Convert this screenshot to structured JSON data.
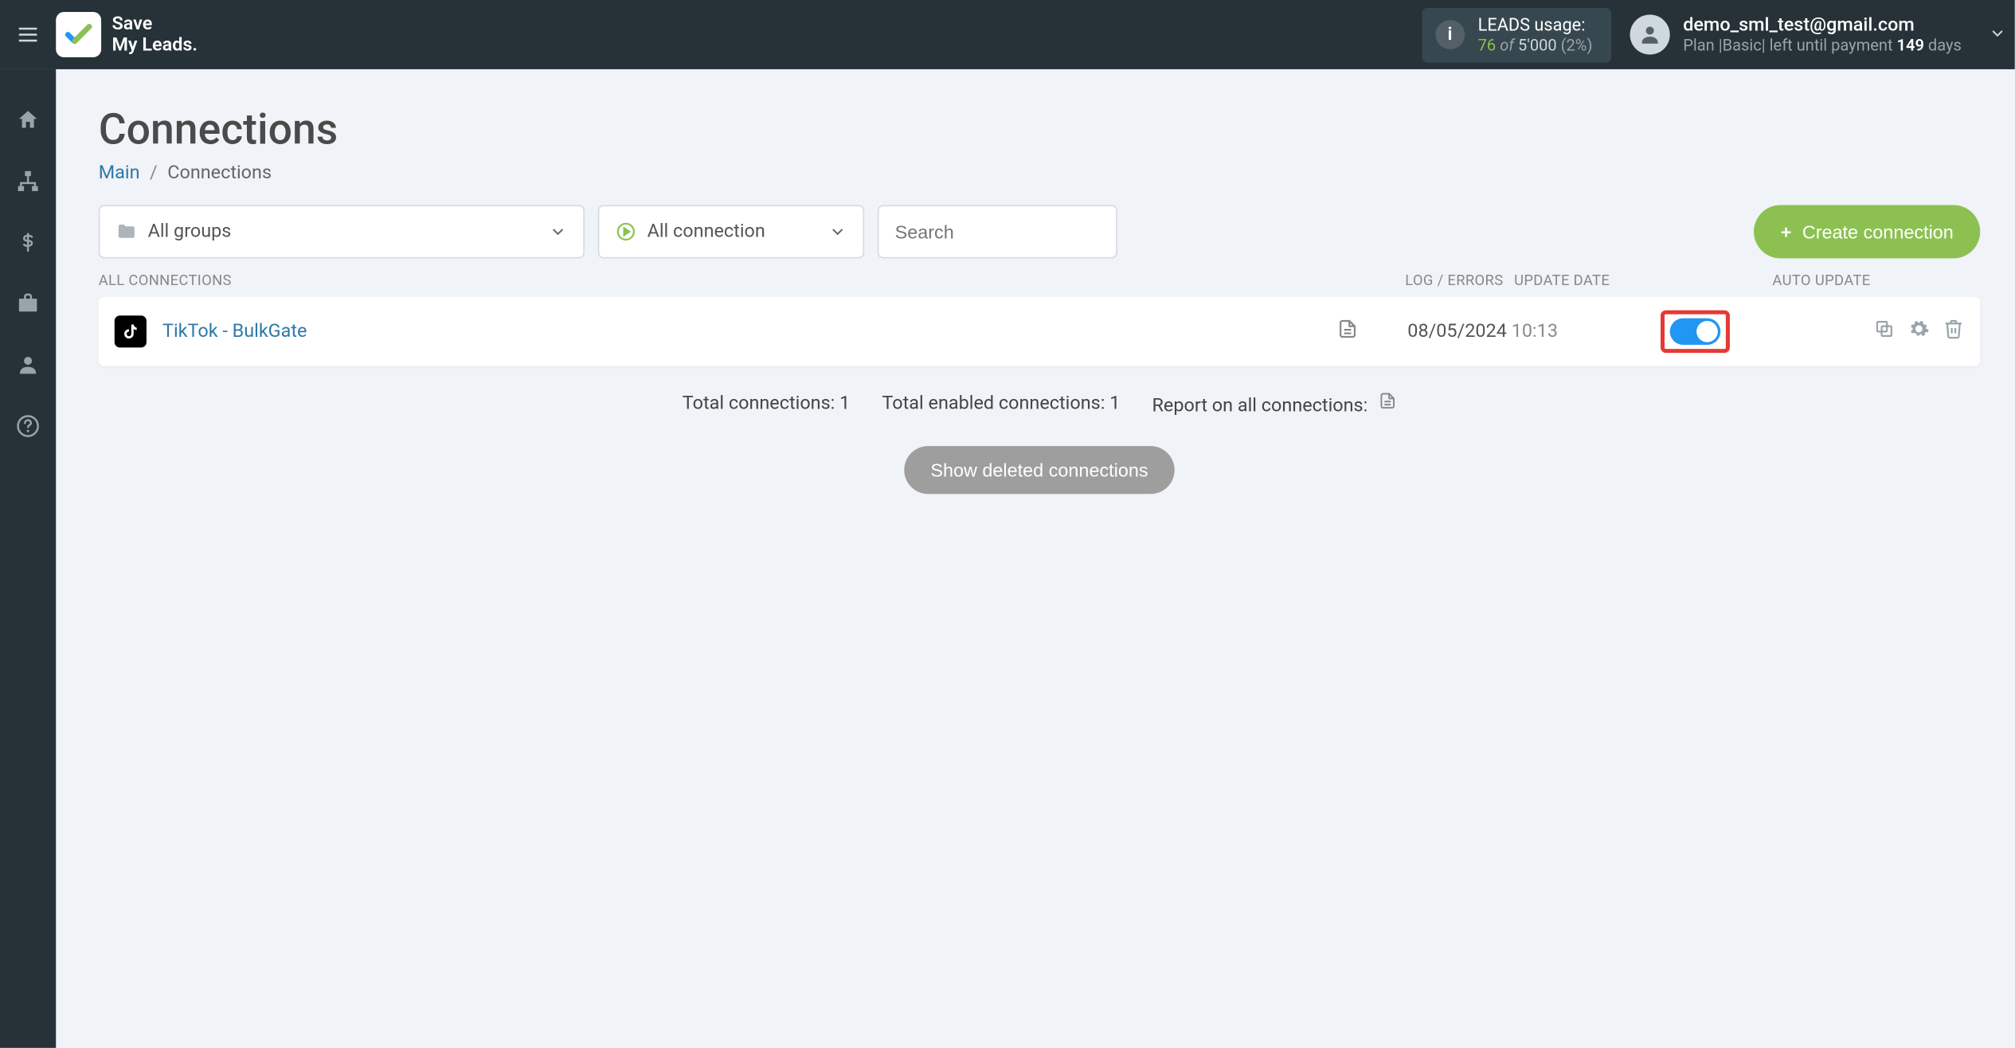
{
  "brand": {
    "line1": "Save",
    "line2": "My Leads."
  },
  "leads_usage": {
    "label": "LEADS usage:",
    "used": "76",
    "of": "of",
    "total": "5'000",
    "percent": "(2%)"
  },
  "account": {
    "email": "demo_sml_test@gmail.com",
    "plan_prefix": "Plan |",
    "plan_name": "Basic",
    "plan_mid": "| left until payment ",
    "days_num": "149",
    "days_suffix": " days"
  },
  "page": {
    "title": "Connections",
    "breadcrumb_main": "Main",
    "breadcrumb_sep": "/",
    "breadcrumb_current": "Connections"
  },
  "filters": {
    "groups_label": "All groups",
    "connection_label": "All connection",
    "search_placeholder": "Search"
  },
  "create_label": "Create connection",
  "table_headers": {
    "all": "ALL CONNECTIONS",
    "log": "LOG / ERRORS",
    "date": "UPDATE DATE",
    "auto": "AUTO UPDATE"
  },
  "rows": [
    {
      "name": "TikTok - BulkGate",
      "date": "08/05/2024",
      "time": "10:13",
      "auto_update": true
    }
  ],
  "summary": {
    "total_label": "Total connections: ",
    "total_value": "1",
    "enabled_label": "Total enabled connections: ",
    "enabled_value": "1",
    "report_label": "Report on all connections:"
  },
  "show_deleted_label": "Show deleted connections"
}
